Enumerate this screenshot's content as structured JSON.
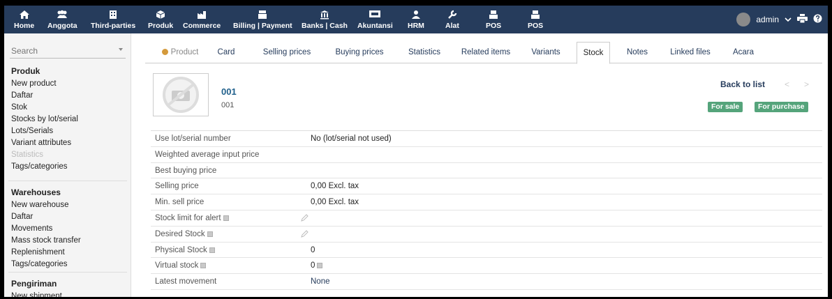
{
  "topnav": {
    "items": [
      {
        "label": "Home",
        "icon": "home-icon"
      },
      {
        "label": "Anggota",
        "icon": "users-icon"
      },
      {
        "label": "Third-parties",
        "icon": "building-icon"
      },
      {
        "label": "Produk",
        "icon": "cube-icon"
      },
      {
        "label": "Commerce",
        "icon": "factory-icon"
      },
      {
        "label": "Billing | Payment",
        "icon": "invoice-icon"
      },
      {
        "label": "Banks | Cash",
        "icon": "bank-icon"
      },
      {
        "label": "Akuntansi",
        "icon": "ledger-icon"
      },
      {
        "label": "HRM",
        "icon": "person-icon"
      },
      {
        "label": "Alat",
        "icon": "wrench-icon"
      },
      {
        "label": "POS",
        "icon": "register-icon"
      },
      {
        "label": "POS",
        "icon": "register-icon"
      }
    ],
    "user": "admin"
  },
  "sidebar": {
    "search_placeholder": "Search",
    "sections": [
      {
        "title": "Produk",
        "links": [
          "New product",
          "Daftar",
          "Stok",
          "Stocks by lot/serial",
          "Lots/Serials",
          "Variant attributes",
          "Statistics",
          "Tags/categories"
        ]
      },
      {
        "title": "Warehouses",
        "links": [
          "New warehouse",
          "Daftar",
          "Movements",
          "Mass stock transfer",
          "Replenishment",
          "Tags/categories"
        ]
      },
      {
        "title": "Pengiriman",
        "links": [
          "New shipment"
        ]
      }
    ]
  },
  "tabs": [
    "Product",
    "Card",
    "Selling prices",
    "Buying prices",
    "Statistics",
    "Related items",
    "Variants",
    "Stock",
    "Notes",
    "Linked files",
    "Acara"
  ],
  "product": {
    "ref": "001",
    "label": "001",
    "back_to_list": "Back to list",
    "prev": "<",
    "next": ">",
    "badges": [
      "For sale",
      "For purchase"
    ]
  },
  "stock_rows": [
    {
      "key": "Use lot/serial number",
      "value": "No (lot/serial not used)"
    },
    {
      "key": "Weighted average input price",
      "value": ""
    },
    {
      "key": "Best buying price",
      "value": ""
    },
    {
      "key": "Selling price",
      "value": "0,00 Excl. tax"
    },
    {
      "key": "Min. sell price",
      "value": "0,00 Excl. tax"
    },
    {
      "key": "Stock limit for alert",
      "value": ""
    },
    {
      "key": "Desired Stock",
      "value": ""
    },
    {
      "key": "Physical Stock",
      "value": "0"
    },
    {
      "key": "Virtual stock",
      "value": "0"
    },
    {
      "key": "Latest movement",
      "value": "None"
    }
  ],
  "colors": {
    "topbar": "#263c5c",
    "badge": "#55a47b",
    "ref": "#1f5f8b",
    "active_dot": "#d49a3c"
  }
}
